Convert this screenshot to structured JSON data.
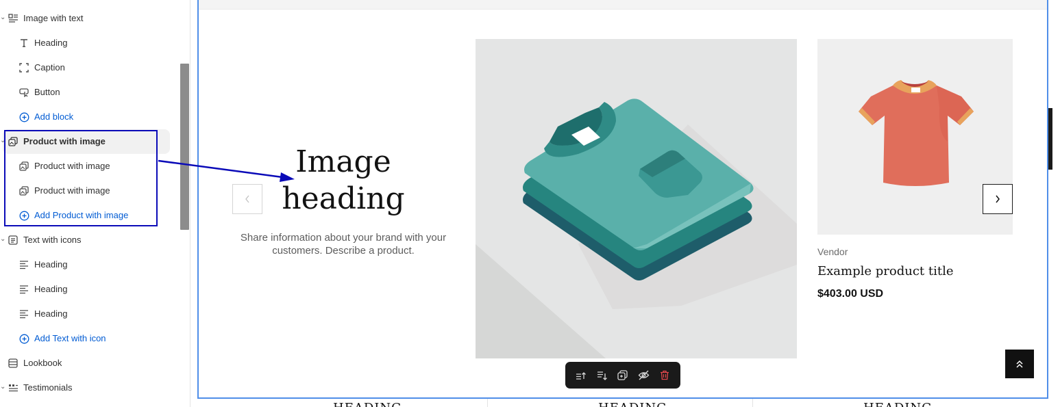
{
  "sidebar": {
    "items": [
      {
        "label": "Image with text",
        "icon": "image-text-icon"
      },
      {
        "label": "Heading",
        "icon": "text-heading-icon"
      },
      {
        "label": "Caption",
        "icon": "caption-icon"
      },
      {
        "label": "Button",
        "icon": "button-icon"
      },
      {
        "label": "Add block",
        "icon": "plus-circle-icon"
      },
      {
        "label": "Product with image",
        "icon": "product-image-icon"
      },
      {
        "label": "Product with image",
        "icon": "product-image-icon"
      },
      {
        "label": "Product with image",
        "icon": "product-image-icon"
      },
      {
        "label": "Add Product with image",
        "icon": "plus-circle-icon"
      },
      {
        "label": "Text with icons",
        "icon": "text-icons-icon"
      },
      {
        "label": "Heading",
        "icon": "align-left-icon"
      },
      {
        "label": "Heading",
        "icon": "align-left-icon"
      },
      {
        "label": "Heading",
        "icon": "align-left-icon"
      },
      {
        "label": "Add Text with icon",
        "icon": "plus-circle-icon"
      },
      {
        "label": "Lookbook",
        "icon": "lookbook-icon"
      },
      {
        "label": "Testimonials",
        "icon": "testimonials-icon"
      }
    ]
  },
  "preview": {
    "image_heading": "Image heading",
    "image_description": "Share information about your brand with your customers. Describe a product.",
    "product": {
      "vendor": "Vendor",
      "title": "Example product title",
      "price": "$403.00 USD"
    },
    "bottom_headings": [
      "HEADING",
      "HEADING",
      "HEADING"
    ]
  },
  "toolbar": {
    "buttons": [
      "move-up-icon",
      "move-down-icon",
      "duplicate-icon",
      "hide-icon",
      "delete-icon"
    ]
  },
  "colors": {
    "accent_blue": "#005bd3",
    "selection_outline": "#4f8ee8",
    "annotation": "#0a0ab8",
    "delete_red": "#e5484d"
  }
}
